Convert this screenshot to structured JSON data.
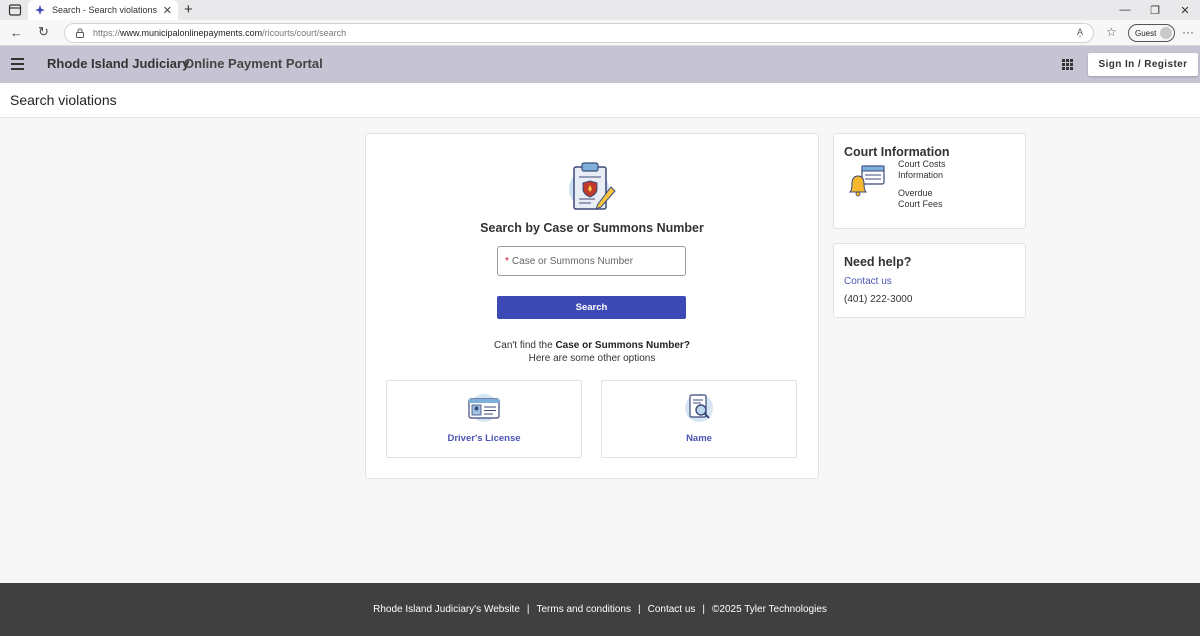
{
  "browser": {
    "tab_title": "Search - Search violations - Online",
    "tab_close": "✕",
    "new_tab": "+",
    "url_protocol": "https://",
    "url_host": "www.municipalonlinepayments.com",
    "url_path": "/ricourts/court/search",
    "read_aloud": "A͔",
    "profile_label": "Guest",
    "more_menu": "···",
    "window_minimize": "—",
    "window_restore": "❐",
    "window_close": "✕"
  },
  "header": {
    "brand": "Rhode Island Judiciary",
    "portal": "Online Payment Portal",
    "signin_label": "Sign In / Register"
  },
  "page": {
    "title": "Search violations"
  },
  "search": {
    "heading": "Search by Case or Summons Number",
    "required_mark": "*",
    "placeholder": "Case or Summons Number",
    "button_label": "Search",
    "cant_find_prefix": "Can't find the ",
    "cant_find_bold": "Case or Summons Number?",
    "other_options": "Here are some other options",
    "options": [
      {
        "label": "Driver's License",
        "icon": "id-card-icon"
      },
      {
        "label": "Name",
        "icon": "document-search-icon"
      }
    ]
  },
  "court_info": {
    "title": "Court Information",
    "links": [
      {
        "line1": "Court Costs",
        "line2": "Information"
      },
      {
        "line1": "Overdue",
        "line2": "Court Fees"
      }
    ]
  },
  "help": {
    "title": "Need help?",
    "contact_label": "Contact us",
    "phone": "(401) 222-3000"
  },
  "footer": {
    "links": [
      "Rhode Island Judiciary's Website",
      "Terms and conditions",
      "Contact us",
      "©2025 Tyler Technologies"
    ],
    "separator": "|"
  },
  "colors": {
    "header_bg": "#c6c4d3",
    "primary_button": "#3d4ab5",
    "link": "#4a55b5",
    "footer_bg": "#404040"
  }
}
